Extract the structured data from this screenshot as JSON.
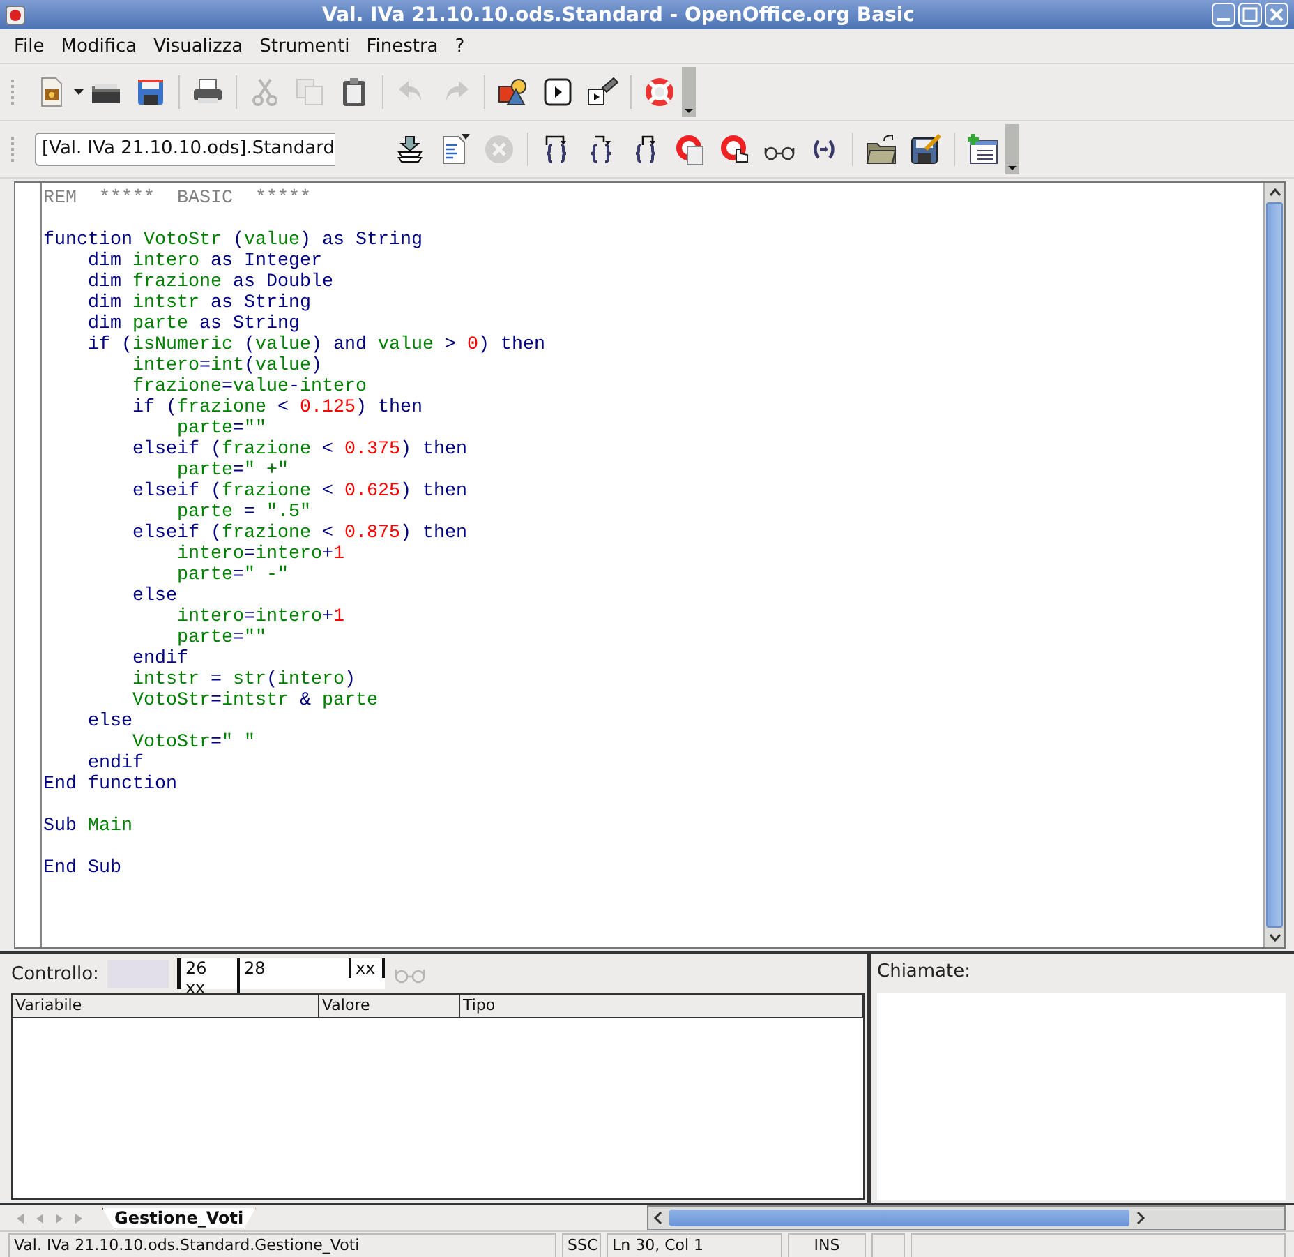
{
  "window": {
    "title": "Val. IVa 21.10.10.ods.Standard - OpenOffice.org Basic"
  },
  "menu": [
    "File",
    "Modifica",
    "Visualizza",
    "Strumenti",
    "Finestra",
    "?"
  ],
  "toolbar_standard": [
    {
      "kind": "new",
      "disabled": false
    },
    {
      "kind": "dropdown",
      "disabled": false
    },
    {
      "kind": "open",
      "disabled": false
    },
    {
      "kind": "save",
      "disabled": false
    },
    {
      "kind": "sep"
    },
    {
      "kind": "print",
      "disabled": false
    },
    {
      "kind": "sep"
    },
    {
      "kind": "cut",
      "disabled": true
    },
    {
      "kind": "copy",
      "disabled": true
    },
    {
      "kind": "paste",
      "disabled": false
    },
    {
      "kind": "sep"
    },
    {
      "kind": "undo",
      "disabled": true
    },
    {
      "kind": "redo",
      "disabled": true
    },
    {
      "kind": "sep"
    },
    {
      "kind": "shapes",
      "disabled": false
    },
    {
      "kind": "run",
      "disabled": false
    },
    {
      "kind": "macros",
      "disabled": false
    },
    {
      "kind": "sep"
    },
    {
      "kind": "help",
      "disabled": false
    },
    {
      "kind": "overflow",
      "disabled": false
    }
  ],
  "library_selector": {
    "value": "[Val. IVa 21.10.10.ods].Standard"
  },
  "toolbar_macro": [
    {
      "kind": "compile",
      "disabled": false
    },
    {
      "kind": "runbasic",
      "disabled": false
    },
    {
      "kind": "stop",
      "disabled": true
    },
    {
      "kind": "sep"
    },
    {
      "kind": "stepinto",
      "disabled": false
    },
    {
      "kind": "stepover",
      "disabled": false
    },
    {
      "kind": "stepout",
      "disabled": false
    },
    {
      "kind": "breakpoint",
      "disabled": false
    },
    {
      "kind": "managebp",
      "disabled": false
    },
    {
      "kind": "watch",
      "disabled": false
    },
    {
      "kind": "brackets",
      "disabled": false
    },
    {
      "kind": "sep"
    },
    {
      "kind": "import",
      "disabled": false
    },
    {
      "kind": "export",
      "disabled": false
    },
    {
      "kind": "sep"
    },
    {
      "kind": "dialog",
      "disabled": false
    },
    {
      "kind": "overflow",
      "disabled": false
    }
  ],
  "code": [
    {
      "gap_before": false,
      "tokens": [
        {
          "kind": "rem",
          "text": "REM  *****  BASIC  *****"
        }
      ]
    },
    {
      "gap_before": true,
      "tokens": [
        {
          "kind": "kw",
          "text": "function"
        },
        {
          "kind": "id",
          "text": " VotoStr "
        },
        {
          "kind": "op",
          "text": "("
        },
        {
          "kind": "id",
          "text": "value"
        },
        {
          "kind": "op",
          "text": ")"
        },
        {
          "kind": "kw",
          "text": " as String"
        }
      ]
    },
    {
      "gap_before": false,
      "tokens": [
        {
          "kind": "kw",
          "text": "    dim "
        },
        {
          "kind": "id",
          "text": "intero"
        },
        {
          "kind": "kw",
          "text": " as Integer"
        }
      ]
    },
    {
      "gap_before": false,
      "tokens": [
        {
          "kind": "kw",
          "text": "    dim "
        },
        {
          "kind": "id",
          "text": "frazione"
        },
        {
          "kind": "kw",
          "text": " as Double"
        }
      ]
    },
    {
      "gap_before": false,
      "tokens": [
        {
          "kind": "kw",
          "text": "    dim "
        },
        {
          "kind": "id",
          "text": "intstr"
        },
        {
          "kind": "kw",
          "text": " as String"
        }
      ]
    },
    {
      "gap_before": false,
      "tokens": [
        {
          "kind": "kw",
          "text": "    dim "
        },
        {
          "kind": "id",
          "text": "parte"
        },
        {
          "kind": "kw",
          "text": " as String"
        }
      ]
    },
    {
      "gap_before": false,
      "tokens": [
        {
          "kind": "kw",
          "text": "    if "
        },
        {
          "kind": "op",
          "text": "("
        },
        {
          "kind": "id",
          "text": "isNumeric "
        },
        {
          "kind": "op",
          "text": "("
        },
        {
          "kind": "id",
          "text": "value"
        },
        {
          "kind": "op",
          "text": ") "
        },
        {
          "kind": "kw",
          "text": "and "
        },
        {
          "kind": "id",
          "text": "value "
        },
        {
          "kind": "op",
          "text": "> "
        },
        {
          "kind": "num",
          "text": "0"
        },
        {
          "kind": "op",
          "text": ") "
        },
        {
          "kind": "kw",
          "text": "then"
        }
      ]
    },
    {
      "gap_before": false,
      "tokens": [
        {
          "kind": "id",
          "text": "        intero"
        },
        {
          "kind": "op",
          "text": "="
        },
        {
          "kind": "id",
          "text": "int"
        },
        {
          "kind": "op",
          "text": "("
        },
        {
          "kind": "id",
          "text": "value"
        },
        {
          "kind": "op",
          "text": ")"
        }
      ]
    },
    {
      "gap_before": false,
      "tokens": [
        {
          "kind": "id",
          "text": "        frazione"
        },
        {
          "kind": "op",
          "text": "="
        },
        {
          "kind": "id",
          "text": "value"
        },
        {
          "kind": "op",
          "text": "-"
        },
        {
          "kind": "id",
          "text": "intero"
        }
      ]
    },
    {
      "gap_before": false,
      "tokens": [
        {
          "kind": "kw",
          "text": "        if "
        },
        {
          "kind": "op",
          "text": "("
        },
        {
          "kind": "id",
          "text": "frazione "
        },
        {
          "kind": "op",
          "text": "< "
        },
        {
          "kind": "num",
          "text": "0.125"
        },
        {
          "kind": "op",
          "text": ") "
        },
        {
          "kind": "kw",
          "text": "then"
        }
      ]
    },
    {
      "gap_before": false,
      "tokens": [
        {
          "kind": "id",
          "text": "            parte"
        },
        {
          "kind": "op",
          "text": "="
        },
        {
          "kind": "str",
          "text": "\"\""
        }
      ]
    },
    {
      "gap_before": false,
      "tokens": [
        {
          "kind": "kw",
          "text": "        elseif "
        },
        {
          "kind": "op",
          "text": "("
        },
        {
          "kind": "id",
          "text": "frazione "
        },
        {
          "kind": "op",
          "text": "< "
        },
        {
          "kind": "num",
          "text": "0.375"
        },
        {
          "kind": "op",
          "text": ") "
        },
        {
          "kind": "kw",
          "text": "then"
        }
      ]
    },
    {
      "gap_before": false,
      "tokens": [
        {
          "kind": "id",
          "text": "            parte"
        },
        {
          "kind": "op",
          "text": "="
        },
        {
          "kind": "str",
          "text": "\" +\""
        }
      ]
    },
    {
      "gap_before": false,
      "tokens": [
        {
          "kind": "kw",
          "text": "        elseif "
        },
        {
          "kind": "op",
          "text": "("
        },
        {
          "kind": "id",
          "text": "frazione "
        },
        {
          "kind": "op",
          "text": "< "
        },
        {
          "kind": "num",
          "text": "0.625"
        },
        {
          "kind": "op",
          "text": ") "
        },
        {
          "kind": "kw",
          "text": "then"
        }
      ]
    },
    {
      "gap_before": false,
      "tokens": [
        {
          "kind": "id",
          "text": "            parte "
        },
        {
          "kind": "op",
          "text": "= "
        },
        {
          "kind": "str",
          "text": "\".5\""
        }
      ]
    },
    {
      "gap_before": false,
      "tokens": [
        {
          "kind": "kw",
          "text": "        elseif "
        },
        {
          "kind": "op",
          "text": "("
        },
        {
          "kind": "id",
          "text": "frazione "
        },
        {
          "kind": "op",
          "text": "< "
        },
        {
          "kind": "num",
          "text": "0.875"
        },
        {
          "kind": "op",
          "text": ") "
        },
        {
          "kind": "kw",
          "text": "then"
        }
      ]
    },
    {
      "gap_before": false,
      "tokens": [
        {
          "kind": "id",
          "text": "            intero"
        },
        {
          "kind": "op",
          "text": "="
        },
        {
          "kind": "id",
          "text": "intero"
        },
        {
          "kind": "op",
          "text": "+"
        },
        {
          "kind": "num",
          "text": "1"
        }
      ]
    },
    {
      "gap_before": false,
      "tokens": [
        {
          "kind": "id",
          "text": "            parte"
        },
        {
          "kind": "op",
          "text": "="
        },
        {
          "kind": "str",
          "text": "\" -\""
        }
      ]
    },
    {
      "gap_before": false,
      "tokens": [
        {
          "kind": "kw",
          "text": "        else"
        }
      ]
    },
    {
      "gap_before": false,
      "tokens": [
        {
          "kind": "id",
          "text": "            intero"
        },
        {
          "kind": "op",
          "text": "="
        },
        {
          "kind": "id",
          "text": "intero"
        },
        {
          "kind": "op",
          "text": "+"
        },
        {
          "kind": "num",
          "text": "1"
        }
      ]
    },
    {
      "gap_before": false,
      "tokens": [
        {
          "kind": "id",
          "text": "            parte"
        },
        {
          "kind": "op",
          "text": "="
        },
        {
          "kind": "str",
          "text": "\"\""
        }
      ]
    },
    {
      "gap_before": false,
      "tokens": [
        {
          "kind": "kw",
          "text": "        endif"
        }
      ]
    },
    {
      "gap_before": false,
      "tokens": [
        {
          "kind": "id",
          "text": "        intstr "
        },
        {
          "kind": "op",
          "text": "= "
        },
        {
          "kind": "id",
          "text": "str"
        },
        {
          "kind": "op",
          "text": "("
        },
        {
          "kind": "id",
          "text": "intero"
        },
        {
          "kind": "op",
          "text": ")"
        }
      ]
    },
    {
      "gap_before": false,
      "tokens": [
        {
          "kind": "id",
          "text": "        VotoStr"
        },
        {
          "kind": "op",
          "text": "="
        },
        {
          "kind": "id",
          "text": "intstr "
        },
        {
          "kind": "op",
          "text": "& "
        },
        {
          "kind": "id",
          "text": "parte"
        }
      ]
    },
    {
      "gap_before": false,
      "tokens": [
        {
          "kind": "kw",
          "text": "    else"
        }
      ]
    },
    {
      "gap_before": false,
      "tokens": [
        {
          "kind": "id",
          "text": "        VotoStr"
        },
        {
          "kind": "op",
          "text": "="
        },
        {
          "kind": "str",
          "text": "\" \""
        }
      ]
    },
    {
      "gap_before": false,
      "tokens": [
        {
          "kind": "kw",
          "text": "    endif"
        }
      ]
    },
    {
      "gap_before": false,
      "tokens": [
        {
          "kind": "kw",
          "text": "End function"
        }
      ]
    },
    {
      "gap_before": true,
      "tokens": [
        {
          "kind": "kw",
          "text": "Sub "
        },
        {
          "kind": "id",
          "text": "Main"
        }
      ]
    },
    {
      "gap_before": true,
      "tokens": [
        {
          "kind": "kw",
          "text": "End Sub"
        }
      ]
    }
  ],
  "watch": {
    "label": "Controllo:",
    "overlay_cells": [
      "26",
      "28",
      "xx",
      "xx"
    ],
    "columns": [
      "Variabile",
      "Valore",
      "Tipo"
    ]
  },
  "calls": {
    "label": "Chiamate:"
  },
  "module_tabs": [
    {
      "label": "Gestione_Voti",
      "selected": true
    }
  ],
  "status_bar": {
    "location": "Val. IVa 21.10.10.ods.Standard.Gestione_Voti",
    "ssc": "SSC",
    "position": "Ln 30, Col 1",
    "mode": "INS"
  }
}
